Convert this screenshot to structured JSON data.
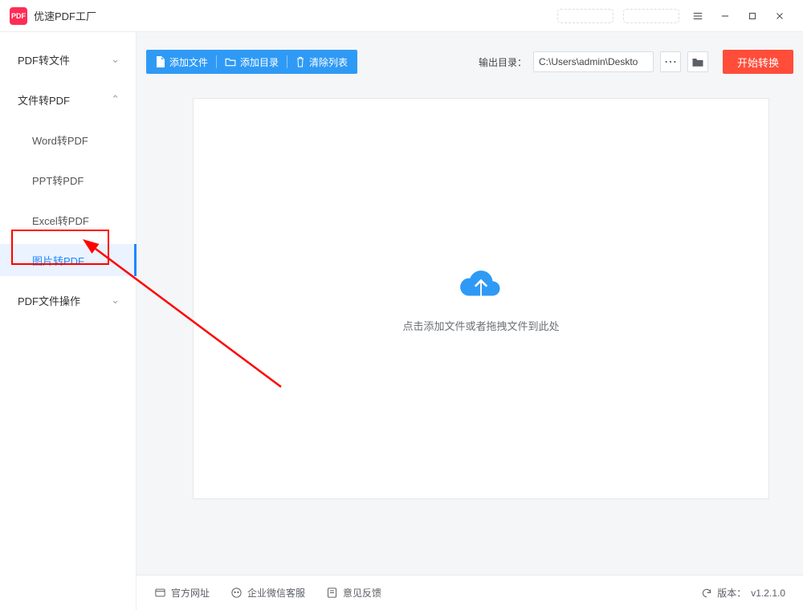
{
  "app": {
    "title": "优速PDF工厂",
    "logo_text": "PDF"
  },
  "sidebar": {
    "group1": {
      "label": "PDF转文件"
    },
    "group2": {
      "label": "文件转PDF",
      "items": [
        {
          "label": "Word转PDF"
        },
        {
          "label": "PPT转PDF"
        },
        {
          "label": "Excel转PDF"
        },
        {
          "label": "图片转PDF"
        }
      ]
    },
    "group3": {
      "label": "PDF文件操作"
    }
  },
  "toolbar": {
    "add_file": "添加文件",
    "add_folder": "添加目录",
    "clear_list": "清除列表",
    "outdir_label": "输出目录：",
    "outdir_value": "C:\\Users\\admin\\Deskto",
    "start_button": "开始转换"
  },
  "dropzone": {
    "text": "点击添加文件或者拖拽文件到此处"
  },
  "footer": {
    "site": "官方网址",
    "wechat": "企业微信客服",
    "feedback": "意见反馈",
    "version_label": "版本：",
    "version": "v1.2.1.0"
  },
  "icons": {
    "menu": "menu-icon",
    "min": "minimize-icon",
    "max": "maximize-icon",
    "close": "close-icon"
  },
  "colors": {
    "accent_blue": "#2f9af5",
    "accent_red": "#ff4d3a",
    "brand_pink": "#ff2d55",
    "annotation_red": "#ff0000"
  }
}
